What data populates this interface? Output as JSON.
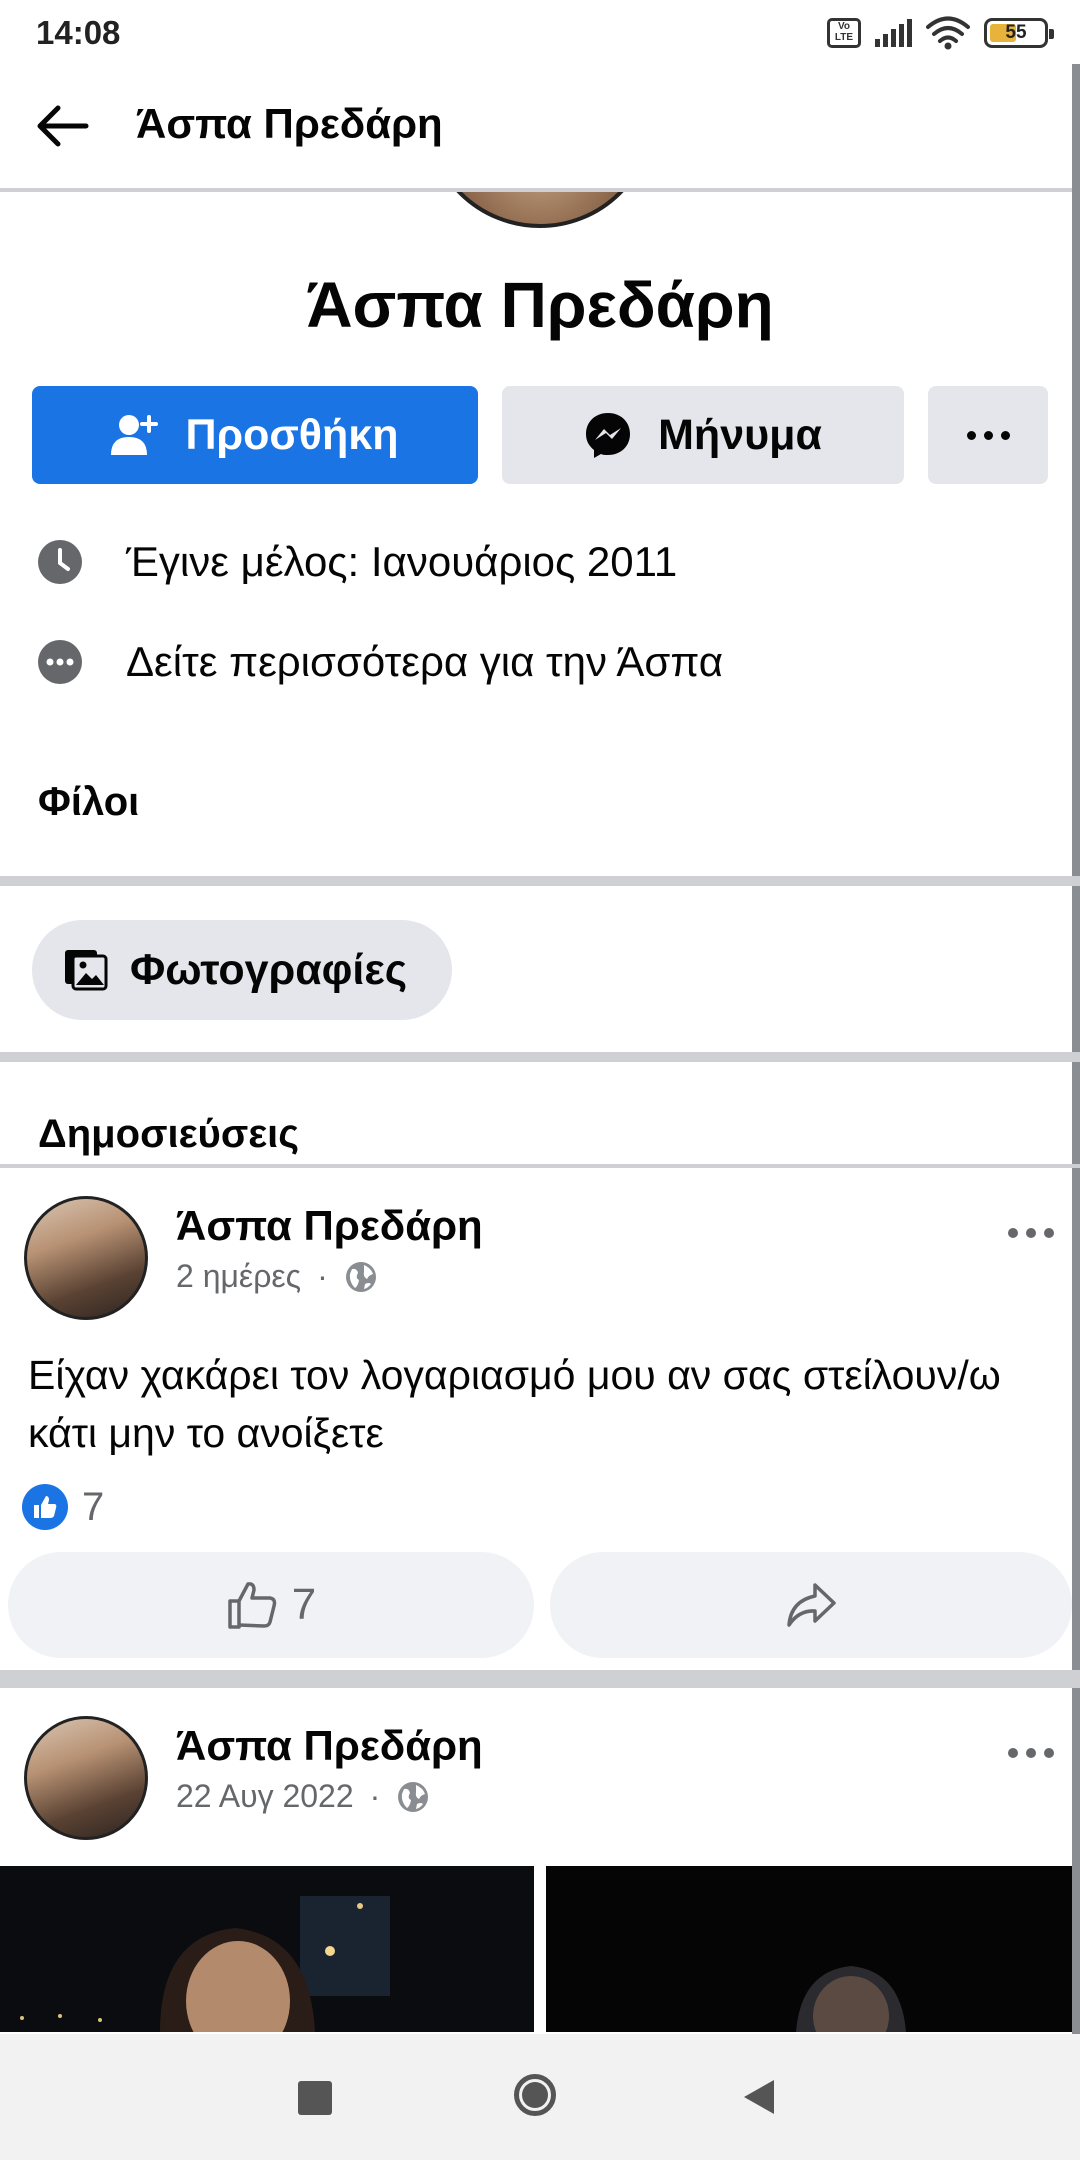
{
  "status_bar": {
    "time": "14:08",
    "volte_label": "Vo LTE",
    "battery_level": "55"
  },
  "header": {
    "title": "Άσπα Πρεδάρη"
  },
  "profile": {
    "name": "Άσπα Πρεδάρη",
    "add_label": "Προσθήκη",
    "message_label": "Μήνυμα",
    "joined_text": "Έγινε μέλος: Ιανουάριος 2011",
    "see_more_text": "Δείτε περισσότερα για την Άσπα",
    "friends_heading": "Φίλοι",
    "photos_label": "Φωτογραφίες",
    "posts_heading": "Δημοσιεύσεις",
    "accent_color": "#1b74e4"
  },
  "posts": [
    {
      "author": "Άσπα Πρεδάρη",
      "time": "2 ημέρες",
      "separator": "·",
      "text": "Είχαν χακάρει τον λογαριασμό μου αν σας στείλουν/ω κάτι μην το ανοίξετε",
      "reaction_count": "7",
      "like_count": "7"
    },
    {
      "author": "Άσπα Πρεδάρη",
      "time": "22 Αυγ 2022",
      "separator": "·"
    }
  ]
}
